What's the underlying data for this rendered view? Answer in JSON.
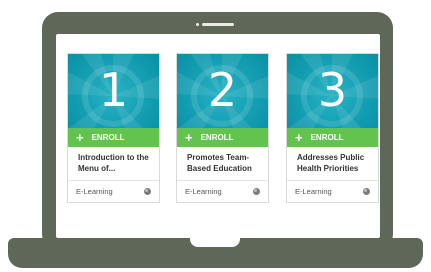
{
  "courses": [
    {
      "number": "1",
      "enroll_label": "ENROLL",
      "title": "Introduction to the Menu of...",
      "type": "E-Learning",
      "type_icon": "globe-icon"
    },
    {
      "number": "2",
      "enroll_label": "ENROLL",
      "title": "Promotes Team-Based Education",
      "type": "E-Learning",
      "type_icon": "globe-icon"
    },
    {
      "number": "3",
      "enroll_label": "ENROLL",
      "title": "Addresses Public Health Priorities",
      "type": "E-Learning",
      "type_icon": "globe-icon"
    }
  ],
  "colors": {
    "laptop_frame": "#5f6758",
    "thumbnail": "#16a2b6",
    "enroll_bar": "#62c34f",
    "card_border": "#d9d9d9"
  }
}
